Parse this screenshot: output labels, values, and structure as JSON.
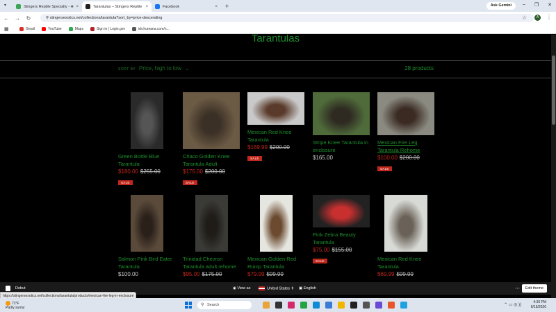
{
  "browser": {
    "tabs": [
      {
        "title": "Stingers Reptile Specialty - Ho…",
        "close": "×",
        "color": "#3aa655",
        "active": false
      },
      {
        "title": "Tarantulas – Stingers Reptile Sp…",
        "close": "×",
        "color": "#222222",
        "active": true
      },
      {
        "title": "Facebook",
        "close": "×",
        "color": "#1877f2",
        "active": false
      }
    ],
    "new_tab": "+",
    "ask_gemini": "Ask Gemini",
    "window_controls": [
      "–",
      "❐",
      "✕"
    ],
    "nav": [
      "←",
      "→",
      "↻",
      "⚲"
    ],
    "url": "stingersexotics.net/collections/tarantula?sort_by=price-descending",
    "star": "☆",
    "profile_initial": "A",
    "menu": "⋮",
    "bookmarks": [
      {
        "label": "Gmail",
        "color": "#d93025"
      },
      {
        "label": "YouTube",
        "color": "#ff0000"
      },
      {
        "label": "Maps",
        "color": "#34a853"
      },
      {
        "label": "Sign in | Login.gov",
        "color": "#b0232a"
      },
      {
        "label": "idv.humana.com/n...",
        "color": "#555555"
      }
    ]
  },
  "page": {
    "heading": "Tarantulas",
    "sort_by_label": "SORT BY",
    "sort_value": "Price, high to low",
    "product_count": "28 products",
    "accent_color": "#1f8f2e",
    "sale_color": "#c0281d"
  },
  "products": [
    {
      "name": "Green Bottle Blue Tarantula",
      "price": "$180.00",
      "compare": "$255.00",
      "sale": true,
      "badge": "SALE",
      "underline": false,
      "img_bg": "#2a2a2a",
      "img_accent": "#555"
    },
    {
      "name": "Chaco Golden Knee Tarantula Adult",
      "price": "$175.00",
      "compare": "$200.00",
      "sale": true,
      "badge": "SALE",
      "underline": false,
      "img_bg": "#6b5a44",
      "img_accent": "#3b3026"
    },
    {
      "name": "Mexican Red Knee Tarantula",
      "price": "$169.99",
      "compare": "$200.00",
      "sale": true,
      "badge": "SALE",
      "underline": false,
      "img_bg": "#c9c9c9",
      "img_accent": "#5a3a2a"
    },
    {
      "name": "Stripe Knee Tarantula in enclosure",
      "price": "$165.00",
      "compare": "",
      "sale": false,
      "badge": "",
      "underline": false,
      "img_bg": "#4f6b3a",
      "img_accent": "#2e2a22"
    },
    {
      "name": "Mexican Fire Leg Tarantula Rehome",
      "price": "$100.00",
      "compare": "$200.00",
      "sale": true,
      "badge": "SALE",
      "underline": true,
      "img_bg": "#8a8a80",
      "img_accent": "#3a2a22"
    },
    {
      "name": "Salmon Pink Bird Eater Tarantula",
      "price": "$100.00",
      "compare": "",
      "sale": false,
      "badge": "",
      "underline": false,
      "img_bg": "#5a4a3a",
      "img_accent": "#2a201a"
    },
    {
      "name": "Trinidad Chevron Tarantula adult rehome",
      "price": "$95.00",
      "compare": "$175.00",
      "sale": true,
      "badge": "",
      "underline": false,
      "img_bg": "#3a3a36",
      "img_accent": "#1f1c18"
    },
    {
      "name": "Mexican Golden Red Rump Tarantula",
      "price": "$79.99",
      "compare": "$99.99",
      "sale": true,
      "badge": "",
      "underline": false,
      "img_bg": "#e6e6e0",
      "img_accent": "#6b4a30"
    },
    {
      "name": "Pink Zebra Beauty Tarantula",
      "price": "$75.00",
      "compare": "$155.00",
      "sale": true,
      "badge": "SALE",
      "underline": false,
      "img_bg": "#222222",
      "img_accent": "#c83030"
    },
    {
      "name": "Mexican Red Knee Tarantula",
      "price": "$69.99",
      "compare": "$99.99",
      "sale": true,
      "badge": "",
      "underline": false,
      "img_bg": "#d8dad6",
      "img_accent": "#6a6258"
    }
  ],
  "theme_bar": {
    "theme": "Debut",
    "view_as": "View as",
    "country": "United States",
    "language": "English",
    "more": "⋯",
    "edit_theme": "Edit theme"
  },
  "status_url": "https://stingersexotics.net/collections/tarantula/products/mexican-fire-leg-in-enclosure",
  "taskbar": {
    "temp": "72°F",
    "weather": "Partly sunny",
    "search_placeholder": "Search",
    "tray": "⌃  ▭  ◎  ))",
    "time": "4:30 PM",
    "date": "6/15/2026"
  }
}
